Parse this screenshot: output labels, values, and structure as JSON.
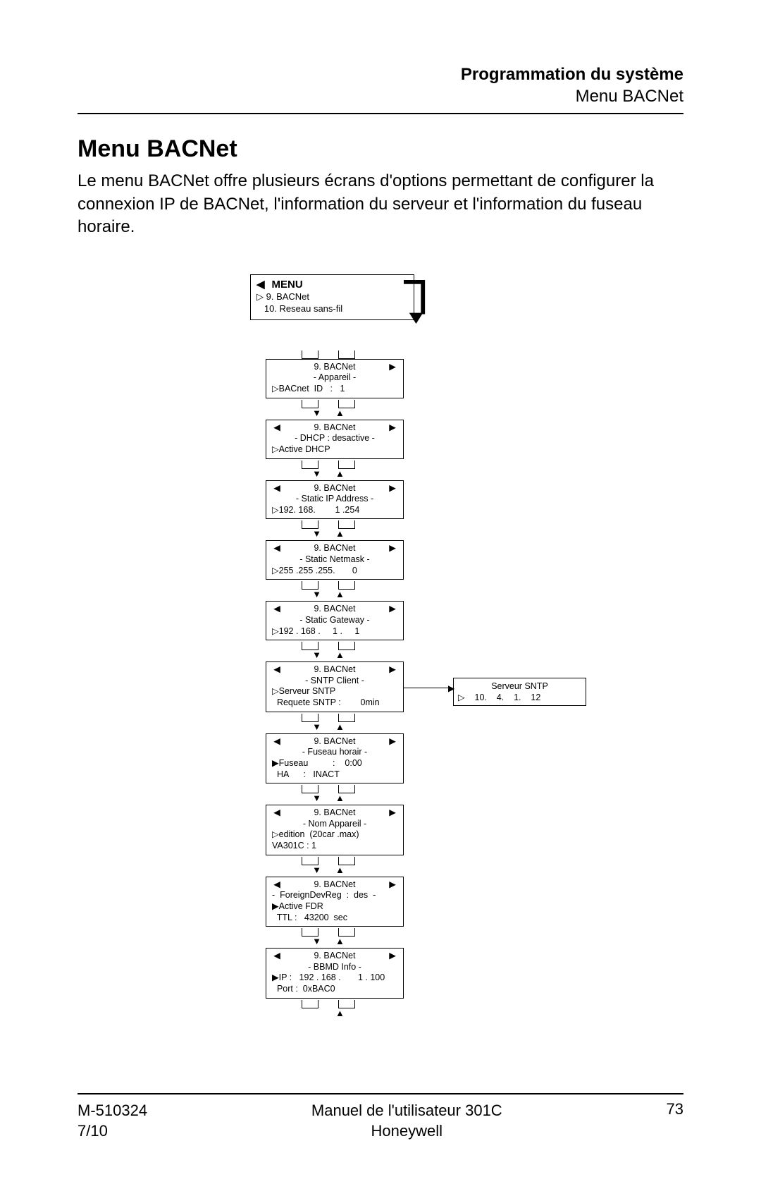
{
  "header": {
    "section": "Programmation du système",
    "subsection": "Menu BACNet"
  },
  "title": "Menu BACNet",
  "intro": "Le menu BACNet offre plusieurs écrans d'options permettant de configurer la connexion IP de BACNet, l'information du serveur et l'information du fuseau horaire.",
  "menu_box": {
    "title": "MENU",
    "items": [
      "▷ 9. BACNet",
      "   10. Reseau sans-fil"
    ]
  },
  "nodes": [
    {
      "left_arrow": false,
      "title": "9. BACNet",
      "lines_center": [
        "- Appareil -"
      ],
      "lines_left": [
        "▷BACnet  ID   :   1"
      ]
    },
    {
      "left_arrow": true,
      "title": "9. BACNet",
      "lines_center": [
        "- DHCP : desactive -"
      ],
      "lines_left": [
        "▷Active DHCP"
      ]
    },
    {
      "left_arrow": true,
      "title": "9. BACNet",
      "lines_center": [
        "- Static IP Address -"
      ],
      "lines_left": [
        "▷192. 168.        1 .254"
      ]
    },
    {
      "left_arrow": true,
      "title": "9. BACNet",
      "lines_center": [
        "- Static Netmask -"
      ],
      "lines_left": [
        "▷255 .255 .255.       0"
      ]
    },
    {
      "left_arrow": true,
      "title": "9. BACNet",
      "lines_center": [
        "- Static Gateway -"
      ],
      "lines_left": [
        "▷192 . 168 .     1 .     1"
      ]
    },
    {
      "left_arrow": true,
      "title": "9. BACNet",
      "lines_center": [
        "- SNTP Client -"
      ],
      "lines_left": [
        "▷Serveur SNTP",
        "  Requete SNTP :        0min"
      ]
    },
    {
      "left_arrow": true,
      "title": "9. BACNet",
      "lines_center": [
        "- Fuseau horair -"
      ],
      "lines_left": [
        "▶Fuseau          :    0:00",
        "  HA      :   INACT"
      ]
    },
    {
      "left_arrow": true,
      "title": "9. BACNet",
      "lines_center": [
        "- Nom Appareil -"
      ],
      "lines_left": [
        "▷edition  (20car .max)",
        "VA301C : 1"
      ]
    },
    {
      "left_arrow": true,
      "title": "9. BACNet",
      "lines_center": [],
      "lines_left": [
        "-  ForeignDevReg  :  des  -",
        "▶Active FDR",
        "  TTL :   43200  sec"
      ]
    },
    {
      "left_arrow": true,
      "title": "9. BACNet",
      "lines_center": [
        "- BBMD  Info -"
      ],
      "lines_left": [
        "▶IP :   192 . 168 .       1 . 100",
        "  Port :  0xBAC0"
      ]
    }
  ],
  "side_box": {
    "title": "Serveur SNTP",
    "value": "▷    10.    4.    1.    12"
  },
  "footer": {
    "left1": "M-510324",
    "left2": "7/10",
    "center1": "Manuel  de l'utilisateur  301C",
    "center2": "Honeywell",
    "page": "73"
  }
}
